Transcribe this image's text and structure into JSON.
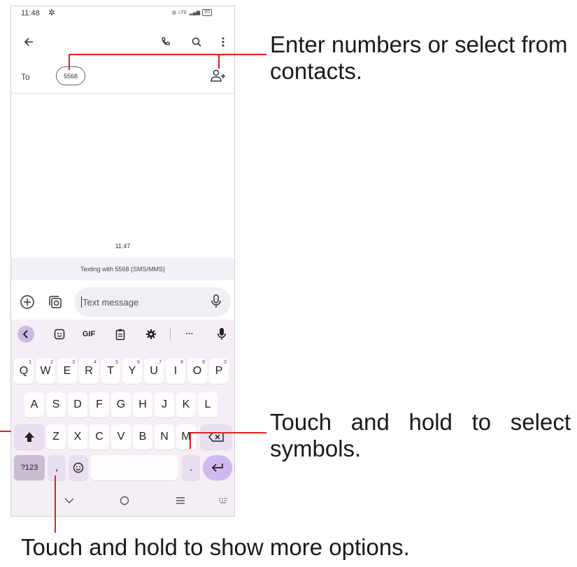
{
  "status_bar": {
    "time": "11:48",
    "battery": "95",
    "network": "LTE"
  },
  "toolbar": {
    "back_icon": "arrow-left-icon",
    "call_icon": "phone-icon",
    "search_icon": "search-icon",
    "menu_icon": "more-vert-icon"
  },
  "recipients": {
    "to_label": "To",
    "chip": "5568",
    "add_icon": "person-add-icon"
  },
  "conversation": {
    "timestamp": "11:47",
    "texting_with": "Texting with 5568 (SMS/MMS)"
  },
  "compose": {
    "placeholder": "Text message"
  },
  "keyboard": {
    "toolbar": [
      "chevron-left-icon",
      "sticker-icon",
      "GIF",
      "clipboard-icon",
      "settings-icon",
      "more-icon",
      "mic-icon"
    ],
    "gif_label": "GIF",
    "more_label": "···",
    "row1": [
      {
        "key": "Q",
        "hint": "1"
      },
      {
        "key": "W",
        "hint": "2"
      },
      {
        "key": "E",
        "hint": "3"
      },
      {
        "key": "R",
        "hint": "4"
      },
      {
        "key": "T",
        "hint": "5"
      },
      {
        "key": "Y",
        "hint": "6"
      },
      {
        "key": "U",
        "hint": "7"
      },
      {
        "key": "I",
        "hint": "8"
      },
      {
        "key": "O",
        "hint": "9"
      },
      {
        "key": "P",
        "hint": "0"
      }
    ],
    "row2": [
      "A",
      "S",
      "D",
      "F",
      "G",
      "H",
      "J",
      "K",
      "L"
    ],
    "row3": [
      "Z",
      "X",
      "C",
      "V",
      "B",
      "N",
      "M"
    ],
    "symbols_key": "?123",
    "comma_key": ",",
    "period_key": "."
  },
  "callouts": {
    "contacts": "Enter numbers or select from contacts.",
    "symbols": "Touch and hold to select symbols.",
    "options": "Touch and hold to show more options."
  },
  "colors": {
    "callout_line": "#e02020",
    "keyboard_bg": "#f6eef7",
    "accent": "#d2b8f0"
  }
}
